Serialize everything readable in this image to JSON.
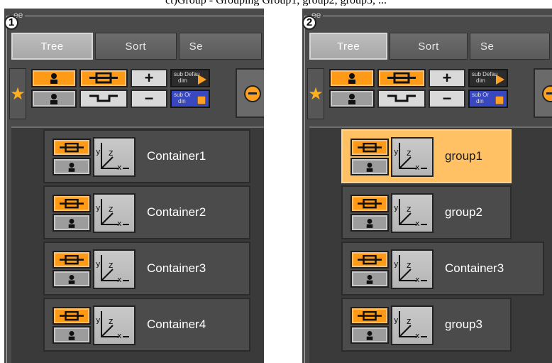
{
  "caption": "ct)Group - Grouping Group1, group2, group3, ...",
  "panels": [
    {
      "badge": "1",
      "title": "ee",
      "tabs": [
        "Tree",
        "Sort",
        "Se"
      ],
      "toolbar": {
        "sub_default_top": "sub Defau",
        "sub_default_bottom": "dim",
        "sub_ortho_top": "sub Or",
        "sub_ortho_bottom": "din"
      },
      "rows": [
        {
          "label": "Container1",
          "selected": false
        },
        {
          "label": "Container2",
          "selected": false
        },
        {
          "label": "Container3",
          "selected": false
        },
        {
          "label": "Container4",
          "selected": false
        }
      ]
    },
    {
      "badge": "2",
      "title": "ee",
      "tabs": [
        "Tree",
        "Sort",
        "Se"
      ],
      "toolbar": {
        "sub_default_top": "sub Defau",
        "sub_default_bottom": "dim",
        "sub_ortho_top": "sub Or",
        "sub_ortho_bottom": "din"
      },
      "rows": [
        {
          "label": "group1",
          "selected": true
        },
        {
          "label": "group2",
          "selected": false
        },
        {
          "label": "Container3",
          "selected": false
        },
        {
          "label": "group3",
          "selected": false
        }
      ]
    }
  ],
  "colors": {
    "accent": "#ff9a16",
    "selection": "#ffc163",
    "panel": "#4a4a4a"
  },
  "icons": [
    "star-icon",
    "person-icon",
    "visibility-eye-icon",
    "plus-icon",
    "minus-icon",
    "zoom-out-icon",
    "axis-icon"
  ]
}
